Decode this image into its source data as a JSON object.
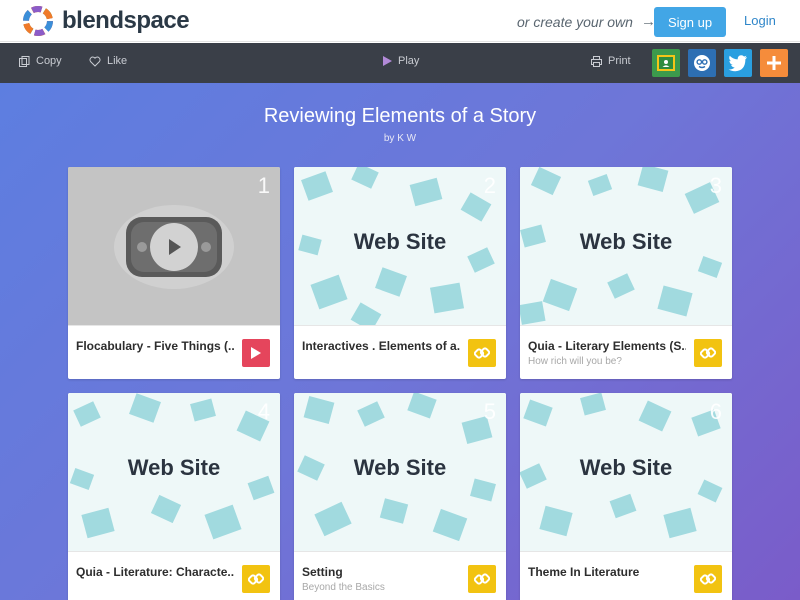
{
  "header": {
    "logo_text": "blendspace",
    "create_own": "or create your own",
    "signup_label": "Sign up",
    "login_label": "Login"
  },
  "toolbar": {
    "copy_label": "Copy",
    "like_label": "Like",
    "play_label": "Play",
    "print_label": "Print",
    "share_buttons": [
      {
        "name": "google-classroom",
        "color": "#3c9a4c"
      },
      {
        "name": "remind",
        "color": "#2d6fb3"
      },
      {
        "name": "twitter",
        "color": "#2a9fe0"
      },
      {
        "name": "add",
        "color": "#f58c3b"
      }
    ]
  },
  "lesson": {
    "title": "Reviewing Elements of a Story",
    "byline": "by K W"
  },
  "cards": [
    {
      "number": "1",
      "type": "video",
      "title": "Flocabulary - Five Things (...",
      "subtitle": ""
    },
    {
      "number": "2",
      "type": "link",
      "thumb_label": "Web Site",
      "title": "Interactives . Elements of a...",
      "subtitle": ""
    },
    {
      "number": "3",
      "type": "link",
      "thumb_label": "Web Site",
      "title": "Quia - Literary Elements (S...",
      "subtitle": "How rich will you be?"
    },
    {
      "number": "4",
      "type": "link",
      "thumb_label": "Web Site",
      "title": "Quia - Literature: Characte...",
      "subtitle": ""
    },
    {
      "number": "5",
      "type": "link",
      "thumb_label": "Web Site",
      "title": "Setting",
      "subtitle": "Beyond the Basics"
    },
    {
      "number": "6",
      "type": "link",
      "thumb_label": "Web Site",
      "title": "Theme In Literature",
      "subtitle": ""
    }
  ],
  "colors": {
    "accent": "#42a6e6",
    "toolbar_bg": "#3a3f48",
    "link_badge": "#f2c311",
    "video_badge": "#e5455c"
  }
}
